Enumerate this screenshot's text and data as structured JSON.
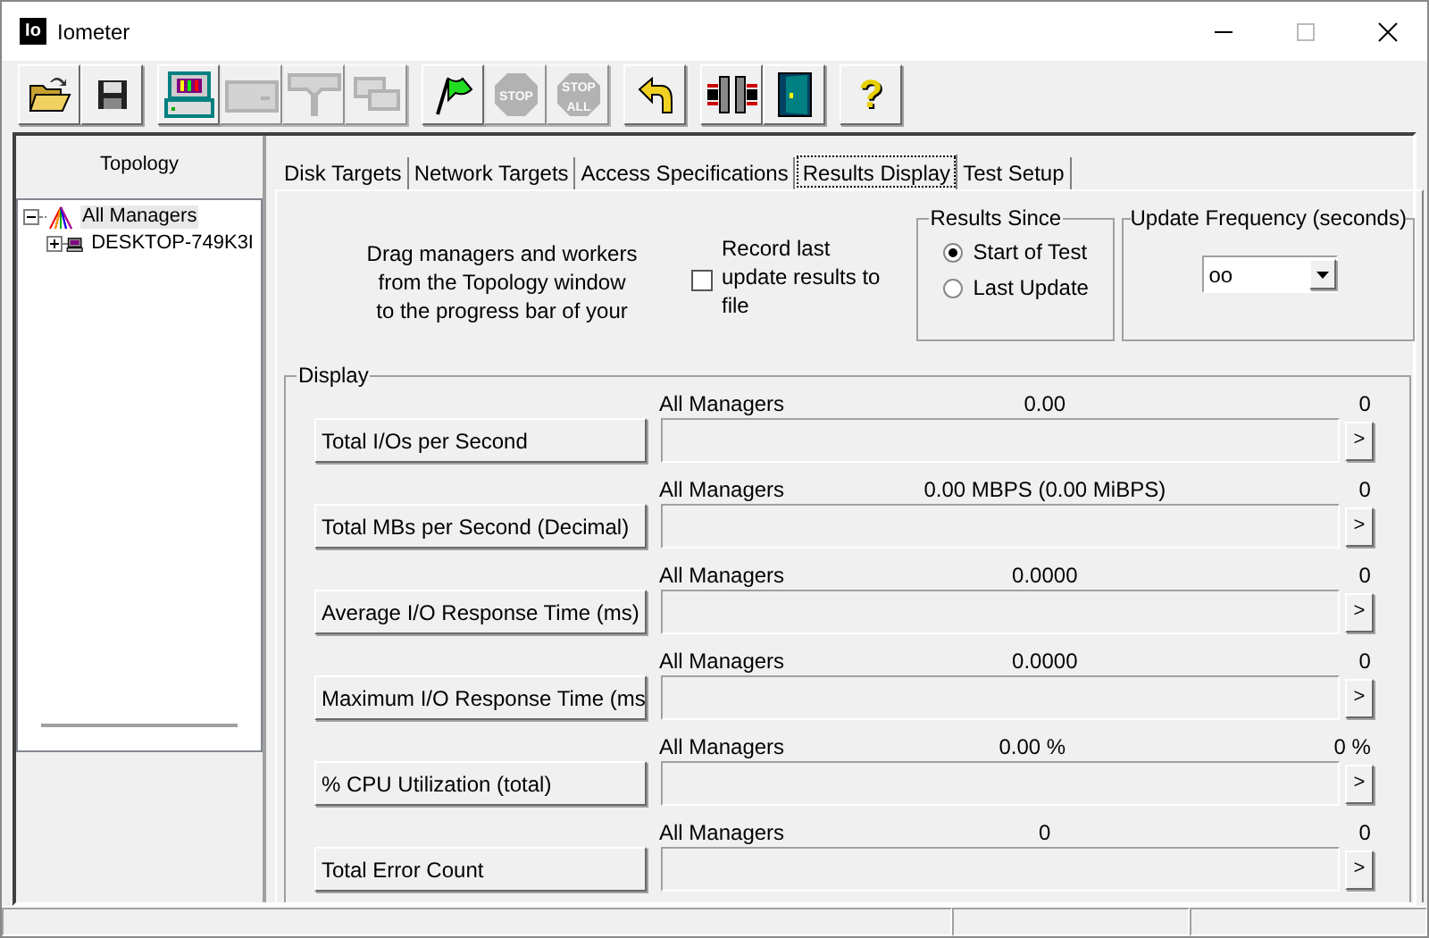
{
  "window": {
    "title": "Iometer",
    "logo": "Io"
  },
  "toolbar": [
    [
      {
        "kind": "open",
        "disabled": false
      },
      {
        "kind": "save",
        "disabled": false
      }
    ],
    [
      {
        "kind": "monitor",
        "disabled": false
      },
      {
        "kind": "disk",
        "disabled": true
      },
      {
        "kind": "network",
        "disabled": true
      },
      {
        "kind": "copy",
        "disabled": true
      }
    ],
    [
      {
        "kind": "flag",
        "disabled": false
      },
      {
        "kind": "stop",
        "disabled": true,
        "label": "STOP"
      },
      {
        "kind": "stopall",
        "disabled": true,
        "label": "STOP",
        "label2": "ALL"
      }
    ],
    [
      {
        "kind": "reset",
        "disabled": false
      }
    ],
    [
      {
        "kind": "connect",
        "disabled": false
      },
      {
        "kind": "exit",
        "disabled": false
      }
    ],
    [
      {
        "kind": "help",
        "disabled": false,
        "label": "?"
      }
    ]
  ],
  "topology": {
    "title": "Topology",
    "tree": [
      {
        "label": "All Managers",
        "expanded": true,
        "selected": true,
        "children": [
          {
            "label": "DESKTOP-749K3I",
            "expanded": false,
            "selected": false
          }
        ]
      }
    ]
  },
  "tabs": [
    {
      "label": "Disk Targets",
      "selected": false
    },
    {
      "label": "Network Targets",
      "selected": false
    },
    {
      "label": "Access Specifications",
      "selected": false
    },
    {
      "label": "Results Display",
      "selected": true
    },
    {
      "label": "Test Setup",
      "selected": false
    }
  ],
  "instructions": [
    "Drag managers and workers",
    "from the Topology window",
    "to the progress bar of your"
  ],
  "record": {
    "label_lines": [
      "Record last",
      "update results to",
      "file"
    ],
    "checked": false
  },
  "results_since": {
    "title": "Results Since",
    "options": [
      {
        "label": "Start of Test",
        "selected": true
      },
      {
        "label": "Last Update",
        "selected": false
      }
    ]
  },
  "update_frequency": {
    "title": "Update Frequency (seconds)",
    "value": "oo"
  },
  "display": {
    "title": "Display",
    "rows": [
      {
        "button": "Total I/Os per Second",
        "target": "All Managers",
        "value": "0.00",
        "max": "0",
        "level": 0
      },
      {
        "button": "Total MBs per Second (Decimal)",
        "target": "All Managers",
        "value": "0.00 MBPS (0.00 MiBPS)",
        "max": "0",
        "level": 0
      },
      {
        "button": "Average I/O Response Time (ms)",
        "target": "All Managers",
        "value": "0.0000",
        "max": "0",
        "level": 0
      },
      {
        "button": "Maximum I/O Response Time (ms",
        "target": "All Managers",
        "value": "0.0000",
        "max": "0",
        "level": 0
      },
      {
        "button": "% CPU Utilization (total)",
        "target": "All Managers",
        "value": "0.00 %",
        "max": "0 %",
        "level": 0
      },
      {
        "button": "Total Error Count",
        "target": "All Managers",
        "value": "0",
        "max": "0",
        "level": 0
      }
    ],
    "arrow": ">"
  }
}
